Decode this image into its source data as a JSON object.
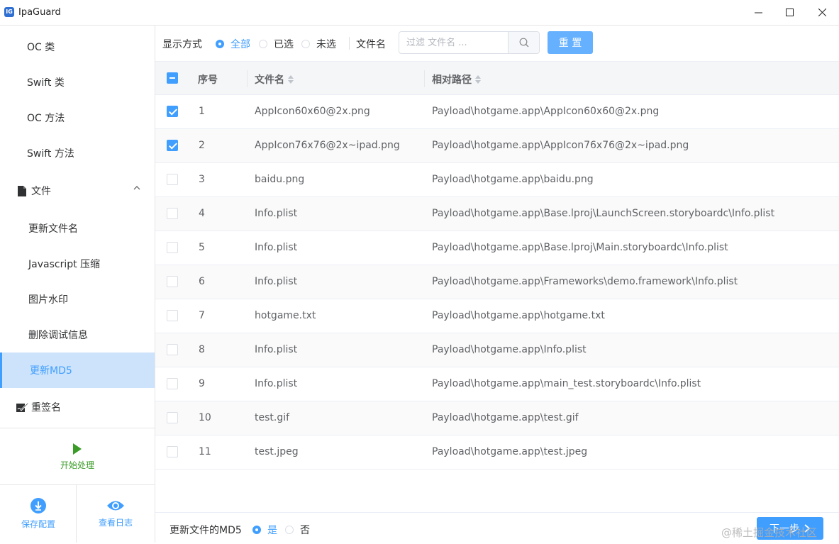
{
  "window": {
    "title": "IpaGuard",
    "logo_text": "IG"
  },
  "sidebar": {
    "items": [
      {
        "label": "OC 类"
      },
      {
        "label": "Swift 类"
      },
      {
        "label": "OC 方法"
      },
      {
        "label": "Swift 方法"
      },
      {
        "label": "文件"
      },
      {
        "label": "更新文件名"
      },
      {
        "label": "Javascript 压缩"
      },
      {
        "label": "图片水印"
      },
      {
        "label": "删除调试信息"
      },
      {
        "label": "更新MD5"
      },
      {
        "label": "重签名"
      }
    ],
    "start_label": "开始处理",
    "save_config_label": "保存配置",
    "view_log_label": "查看日志"
  },
  "toolbar": {
    "display_label": "显示方式",
    "filter_options": [
      "全部",
      "已选",
      "未选"
    ],
    "filter_selected": "全部",
    "filename_label": "文件名",
    "search_placeholder": "过滤 文件名 ...",
    "reset_label": "重 置"
  },
  "table": {
    "columns": [
      "序号",
      "文件名",
      "相对路径"
    ],
    "rows": [
      {
        "index": "1",
        "name": "AppIcon60x60@2x.png",
        "path": "Payload\\hotgame.app\\AppIcon60x60@2x.png",
        "checked": true
      },
      {
        "index": "2",
        "name": "AppIcon76x76@2x~ipad.png",
        "path": "Payload\\hotgame.app\\AppIcon76x76@2x~ipad.png",
        "checked": true
      },
      {
        "index": "3",
        "name": "baidu.png",
        "path": "Payload\\hotgame.app\\baidu.png",
        "checked": false
      },
      {
        "index": "4",
        "name": "Info.plist",
        "path": "Payload\\hotgame.app\\Base.lproj\\LaunchScreen.storyboardc\\Info.plist",
        "checked": false
      },
      {
        "index": "5",
        "name": "Info.plist",
        "path": "Payload\\hotgame.app\\Base.lproj\\Main.storyboardc\\Info.plist",
        "checked": false
      },
      {
        "index": "6",
        "name": "Info.plist",
        "path": "Payload\\hotgame.app\\Frameworks\\demo.framework\\Info.plist",
        "checked": false
      },
      {
        "index": "7",
        "name": "hotgame.txt",
        "path": "Payload\\hotgame.app\\hotgame.txt",
        "checked": false
      },
      {
        "index": "8",
        "name": "Info.plist",
        "path": "Payload\\hotgame.app\\Info.plist",
        "checked": false
      },
      {
        "index": "9",
        "name": "Info.plist",
        "path": "Payload\\hotgame.app\\main_test.storyboardc\\Info.plist",
        "checked": false
      },
      {
        "index": "10",
        "name": "test.gif",
        "path": "Payload\\hotgame.app\\test.gif",
        "checked": false
      },
      {
        "index": "11",
        "name": "test.jpeg",
        "path": "Payload\\hotgame.app\\test.jpeg",
        "checked": false
      }
    ]
  },
  "footer": {
    "md5_label": "更新文件的MD5",
    "yes_label": "是",
    "no_label": "否",
    "selected": "是",
    "next_label": "下一步"
  },
  "watermark": "@稀土掘金技术社区",
  "colors": {
    "accent": "#409eff",
    "active_bg": "#cce3fb",
    "start_green": "#3a9c26"
  }
}
